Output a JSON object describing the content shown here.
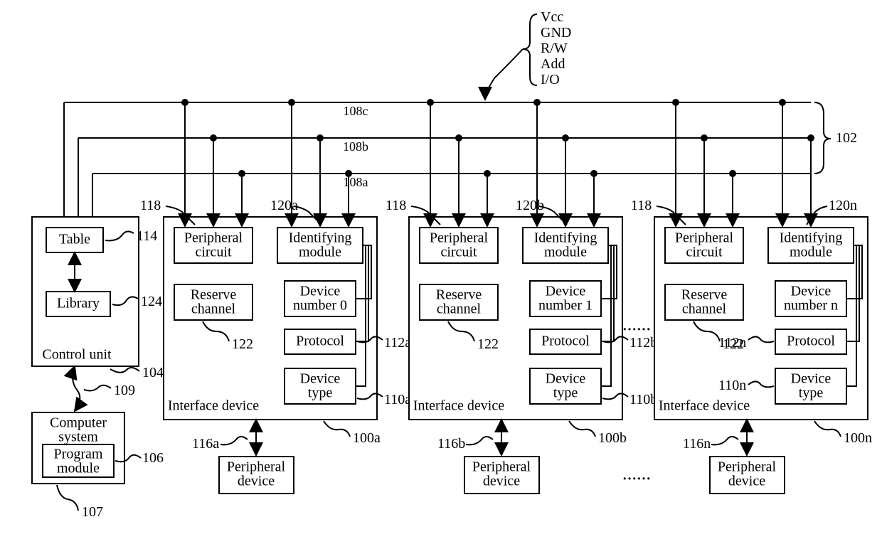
{
  "signals": {
    "vcc": "Vcc",
    "gnd": "GND",
    "rw": "R/W",
    "add": "Add",
    "io": "I/O"
  },
  "bus": {
    "ref102": "102",
    "line108a": "108a",
    "line108b": "108b",
    "line108c": "108c"
  },
  "control": {
    "table": "Table",
    "library": "Library",
    "unit": "Control unit",
    "ref104": "104",
    "ref109": "109",
    "ref114": "114",
    "ref124": "124"
  },
  "computer": {
    "system": "Computer\nsystem",
    "program": "Program\nmodule",
    "ref106": "106",
    "ref107": "107"
  },
  "ellipsis": "……",
  "refs": {
    "r118": "118",
    "r122": "122"
  },
  "devices": [
    {
      "title": "Interface device",
      "peripheral": "Peripheral\ncircuit",
      "reserve": "Reserve\nchannel",
      "identifying": "Identifying\nmodule",
      "devnum": "Device\nnumber 0",
      "protocol": "Protocol",
      "devtype": "Device\ntype",
      "periph": "Peripheral\ndevice",
      "r100": "100a",
      "r110": "110a",
      "r112": "112a",
      "r116": "116a",
      "r120": "120a"
    },
    {
      "title": "Interface device",
      "peripheral": "Peripheral\ncircuit",
      "reserve": "Reserve\nchannel",
      "identifying": "Identifying\nmodule",
      "devnum": "Device\nnumber 1",
      "protocol": "Protocol",
      "devtype": "Device\ntype",
      "periph": "Peripheral\ndevice",
      "r100": "100b",
      "r110": "110b",
      "r112": "112b",
      "r116": "116b",
      "r120": "120b"
    },
    {
      "title": "Interface device",
      "peripheral": "Peripheral\ncircuit",
      "reserve": "Reserve\nchannel",
      "identifying": "Identifying\nmodule",
      "devnum": "Device\nnumber n",
      "protocol": "Protocol",
      "devtype": "Device\ntype",
      "periph": "Peripheral\ndevice",
      "r100": "100n",
      "r110": "110n",
      "r112": "112n",
      "r116": "116n",
      "r120": "120n"
    }
  ]
}
